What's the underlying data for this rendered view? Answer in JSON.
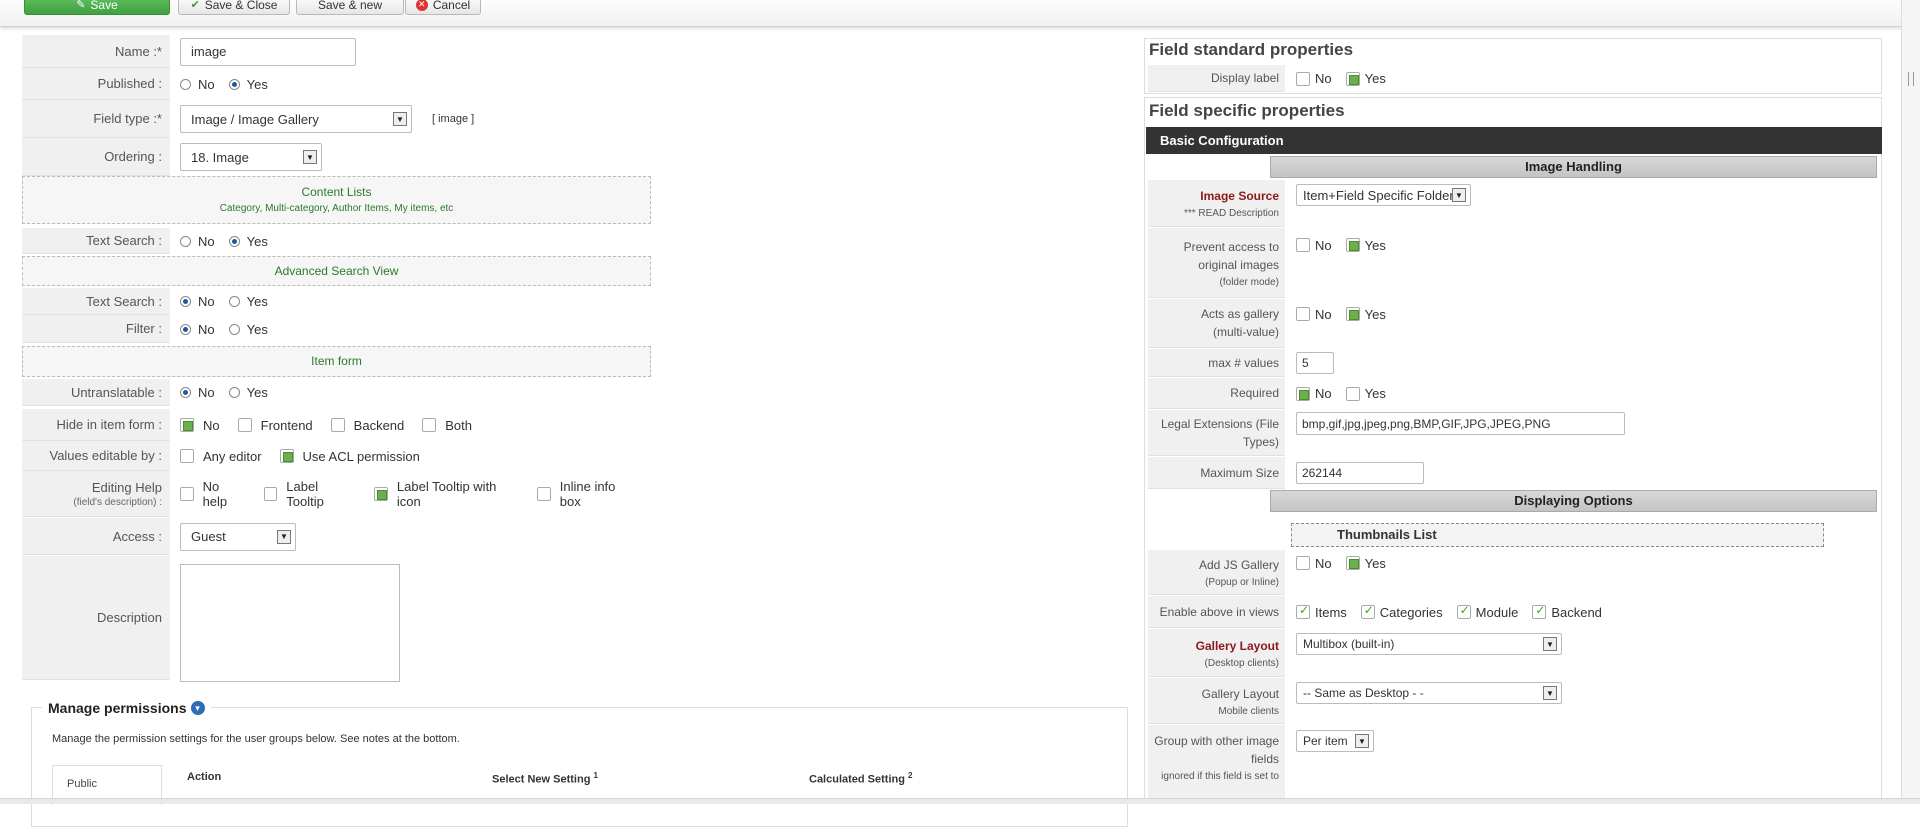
{
  "toolbar": {
    "save": "Save",
    "save_close": "Save & Close",
    "save_new": "Save & new",
    "cancel": "Cancel"
  },
  "form": {
    "name_label": "Name",
    "name_value": "image",
    "published_label": "Published",
    "no": "No",
    "yes": "Yes",
    "field_type_label": "Field type",
    "field_type_value": "Image / Image Gallery",
    "field_type_tag": "[ image ]",
    "ordering_label": "Ordering",
    "ordering_value": "18. Image",
    "content_lists_title": "Content Lists",
    "content_lists_sub": "Category, Multi-category, Author Items, My items, etc",
    "text_search_label": "Text Search",
    "adv_search_title": "Advanced Search View",
    "adv_text_search_label": "Text Search",
    "filter_label": "Filter",
    "item_form_title": "Item form",
    "untranslatable_label": "Untranslatable",
    "hide_label": "Hide in item form",
    "hide_options": [
      "No",
      "Frontend",
      "Backend",
      "Both"
    ],
    "values_editable_label": "Values editable by",
    "any_editor": "Any editor",
    "use_acl": "Use ACL permission",
    "editing_help_label": "Editing Help",
    "editing_help_sub": "(field's description)",
    "editing_help_options": [
      "No help",
      "Label Tooltip",
      "Label Tooltip with icon",
      "Inline info box"
    ],
    "access_label": "Access",
    "access_value": "Guest",
    "description_label": "Description"
  },
  "permissions": {
    "title": "Manage permissions",
    "note": "Manage the permission settings for the user groups below. See notes at the bottom.",
    "tab": "Public",
    "col_action": "Action",
    "col_select": "Select New Setting",
    "col_select_sup": "1",
    "col_calc": "Calculated Setting",
    "col_calc_sup": "2"
  },
  "right": {
    "std_title": "Field standard properties",
    "display_label": "Display label",
    "spec_title": "Field specific properties",
    "basic_config": "Basic Configuration",
    "image_handling": "Image Handling",
    "image_source_label": "Image Source",
    "image_source_sub": "*** READ Description",
    "image_source_value": "Item+Field Specific Folder",
    "prevent_label_1": "Prevent access to",
    "prevent_label_2": "original images",
    "prevent_sub": "(folder mode)",
    "acts_label_1": "Acts as gallery",
    "acts_label_2": "(multi-value)",
    "max_values_label": "max # values",
    "max_values_value": "5",
    "required_label": "Required",
    "legal_ext_label_1": "Legal Extensions (File",
    "legal_ext_label_2": "Types)",
    "legal_ext_value": "bmp,gif,jpg,jpeg,png,BMP,GIF,JPG,JPEG,PNG",
    "max_size_label": "Maximum Size",
    "max_size_value": "262144",
    "displaying_options": "Displaying Options",
    "thumbnails_list": "Thumbnails List",
    "add_js_label": "Add JS Gallery",
    "add_js_sub": "(Popup or Inline)",
    "enable_views_label": "Enable above in views",
    "views": [
      "Items",
      "Categories",
      "Module",
      "Backend"
    ],
    "gallery_layout_label": "Gallery Layout",
    "gallery_layout_sub": "(Desktop clients)",
    "gallery_layout_value": "Multibox (built-in)",
    "gallery_mobile_label": "Gallery Layout",
    "gallery_mobile_sub": "Mobile clients",
    "gallery_mobile_value": "-- Same as Desktop - -",
    "group_label_1": "Group with other image",
    "group_label_2": "fields",
    "group_sub": "ignored if this field is set to",
    "group_value": "Per item"
  }
}
